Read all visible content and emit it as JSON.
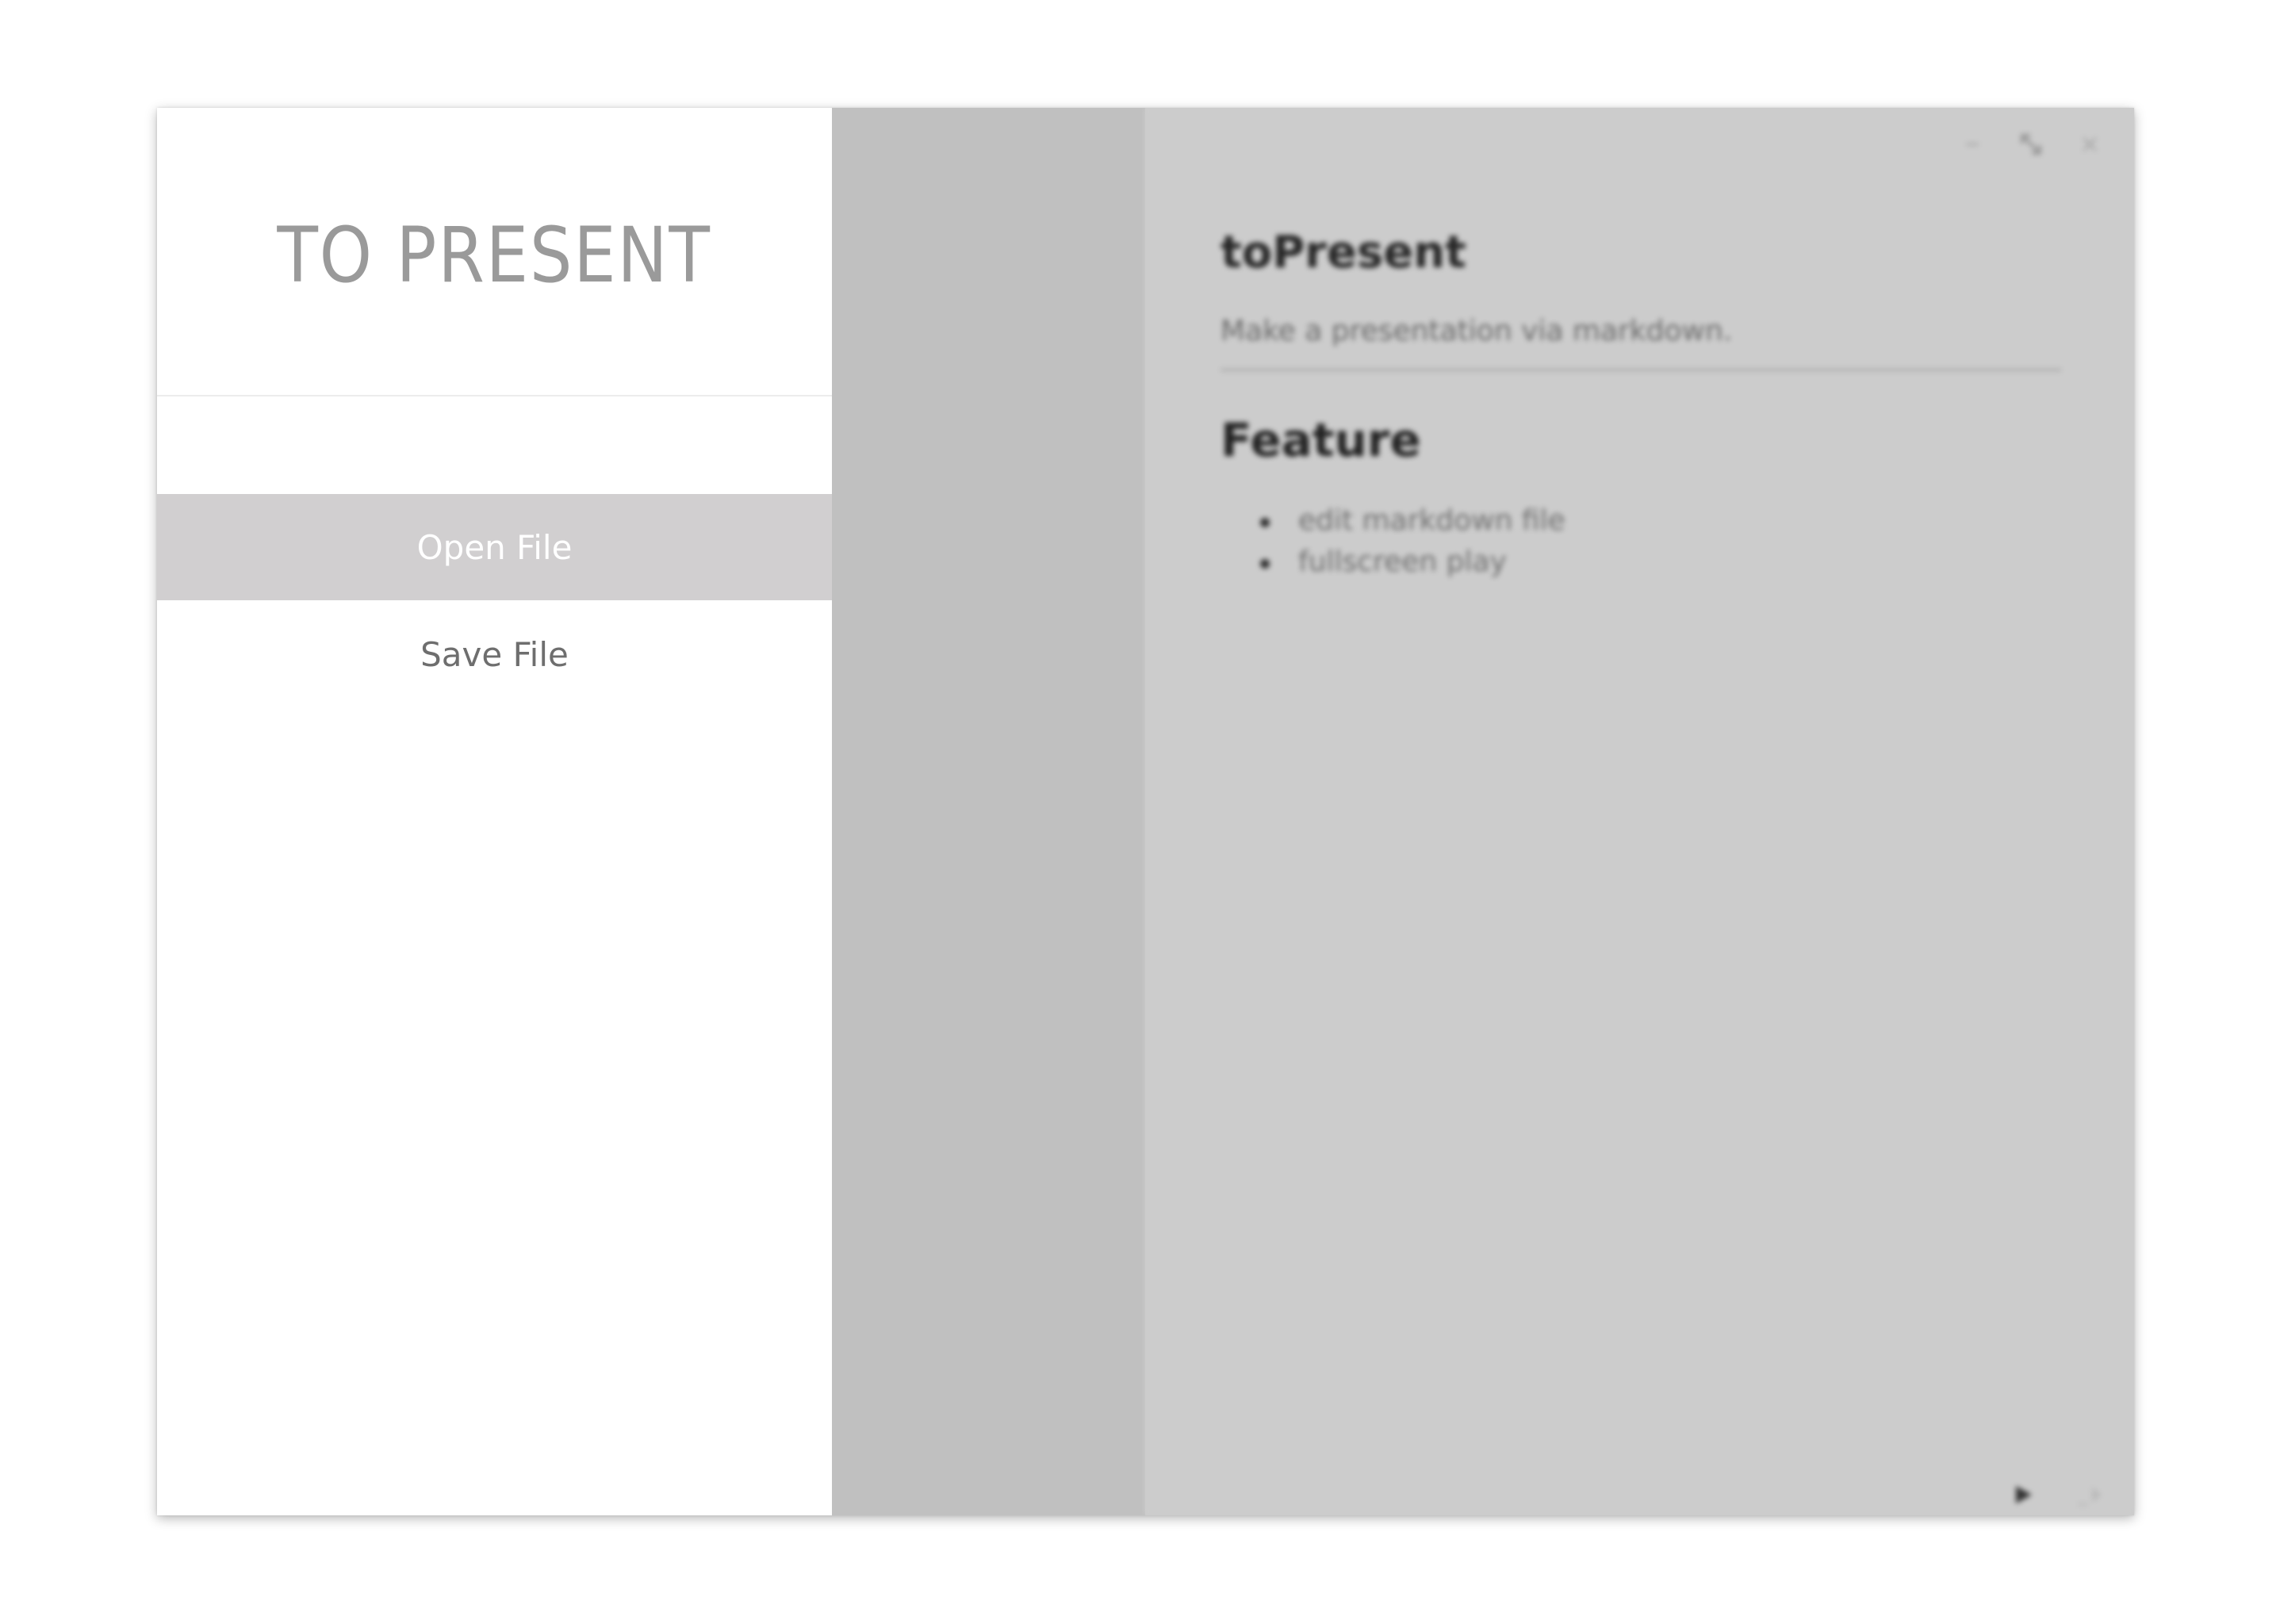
{
  "app": {
    "brand_title": "TO PRESENT"
  },
  "sidebar": {
    "menu": [
      {
        "label": "Open File",
        "active": true
      },
      {
        "label": "Save File",
        "active": false
      }
    ]
  },
  "window_controls": [
    "minimize-icon",
    "maximize-icon",
    "close-icon"
  ],
  "preview": {
    "title": "toPresent",
    "description": "Make a presentation via markdown.",
    "section_heading": "Feature",
    "features": [
      "edit markdown file",
      "fullscreen play"
    ]
  },
  "playback_controls": [
    "play-icon",
    "fullscreen-play-icon"
  ],
  "colors": {
    "sidebar_bg": "#ffffff",
    "active_item_bg": "#d1cfd0",
    "editor_bg": "#c0c0c0",
    "preview_bg": "#cccccc",
    "brand_text": "#9a9a9a"
  }
}
